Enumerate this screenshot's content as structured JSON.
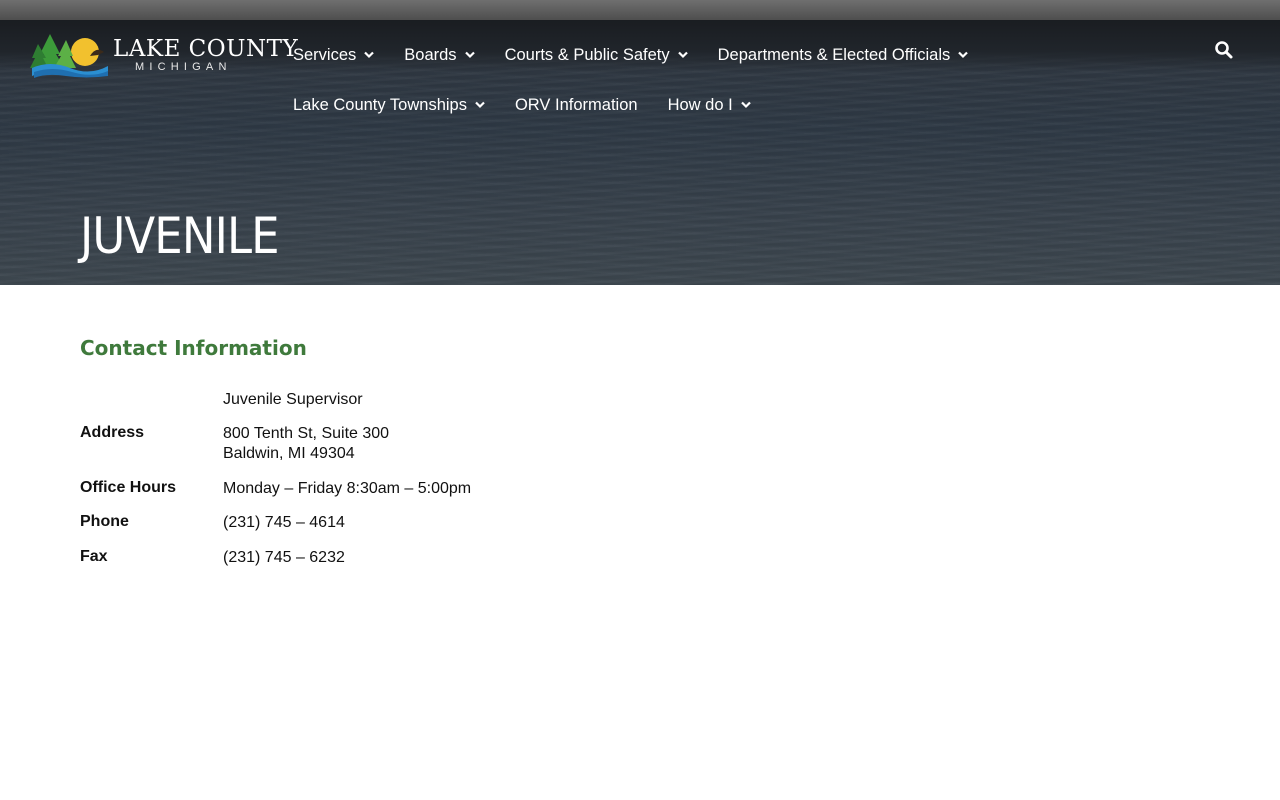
{
  "site": {
    "logo_title": "LAKE COUNTY",
    "logo_subtitle": "MICHIGAN"
  },
  "nav": {
    "row1": [
      {
        "label": "Services",
        "has_dropdown": true
      },
      {
        "label": "Boards",
        "has_dropdown": true
      },
      {
        "label": "Courts & Public Safety",
        "has_dropdown": true
      },
      {
        "label": "Departments & Elected Officials",
        "has_dropdown": true
      }
    ],
    "row2": [
      {
        "label": "Lake County Townships",
        "has_dropdown": true
      },
      {
        "label": "ORV Information",
        "has_dropdown": false
      },
      {
        "label": "How do I",
        "has_dropdown": true
      }
    ],
    "search_icon": "search-icon"
  },
  "page": {
    "title": "JUVENILE"
  },
  "contact": {
    "heading": "Contact Information",
    "supervisor": "Juvenile Supervisor",
    "address_label": "Address",
    "address_line1": "800 Tenth St, Suite 300",
    "address_line2": "Baldwin, MI 49304",
    "hours_label": "Office Hours",
    "hours_value": "Monday – Friday 8:30am – 5:00pm",
    "phone_label": "Phone",
    "phone_value": "(231) 745 – 4614",
    "fax_label": "Fax",
    "fax_value": "(231) 745 – 6232"
  },
  "colors": {
    "heading_green": "#3f7a3c",
    "hero_dark": "#2f3a46"
  }
}
